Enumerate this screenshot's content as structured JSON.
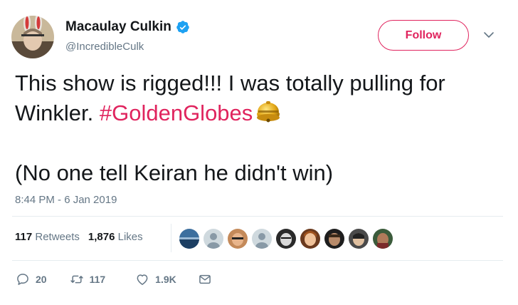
{
  "user": {
    "display_name": "Macaulay Culkin",
    "handle": "@IncredibleCulk",
    "verified": true
  },
  "follow_label": "Follow",
  "tweet": {
    "line1": "This show is rigged!!! I was totally pulling for",
    "line2_text": "Winkler. ",
    "hashtag": "#GoldenGlobes",
    "line3": "(No one tell Keiran he didn't win)"
  },
  "timestamp": "8:44 PM - 6 Jan 2019",
  "stats": {
    "retweets_count": "117",
    "retweets_label": "Retweets",
    "likes_count": "1,876",
    "likes_label": "Likes"
  },
  "actions": {
    "reply_count": "20",
    "retweet_count": "117",
    "like_count": "1.9K"
  },
  "colors": {
    "accent": "#e0245e",
    "verified": "#1da1f2",
    "muted": "#657786",
    "divider": "#e6ecf0"
  },
  "icons": [
    "verified-badge-icon",
    "chevron-down-icon",
    "golden-globe-bell-emoji",
    "reply-icon",
    "retweet-icon",
    "heart-icon",
    "envelope-icon"
  ]
}
